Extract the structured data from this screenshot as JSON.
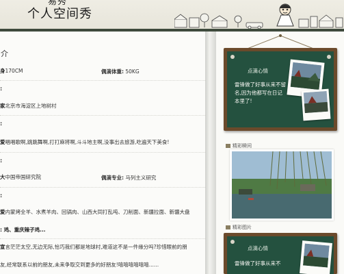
{
  "header": {
    "title": "个人空间秀",
    "title_fragment": "易秀"
  },
  "profile": {
    "section_title": "介",
    "height_label": "身",
    "height_value": "170CM",
    "spouse_weight_label": "偶滴体重:",
    "spouse_weight_value": "50KG",
    "home_label": "家",
    "home_value": "北京市海淀区上地树村",
    "hobby_label": "爱",
    "hobby_value": "唱唱歌啊,跳跳舞啊,打打麻将啊,斗斗地主啊,没事出去旅游,吃遍天下美食!",
    "school_label": "大",
    "school_value": "中国帝国研究院",
    "spouse_major_label": "偶滴专业:",
    "spouse_major_value": "马列主义研究",
    "food_label": "爱",
    "food_value": "内蒙烤全羊、水煮羊肉、回锅肉、山西大同打乱吨、刀削面、新疆拉面、新疆大盘",
    "food_value_2": ": 鸡、重庆辣子鸡...",
    "motto_label": "宣",
    "motto_value": "言茫茫太空,无边无际,恰巧我们都是地球村,难道这不是一件缘分吗?珍惜眼前的朋",
    "motto_value_2": "友,经常联系以前的朋友,未来争取交到更多的好朋友!嘻嘻嘻嘻嘻嘻......",
    "colon": ":"
  },
  "sidebar": {
    "mood_title": "点滴心情",
    "mood_text": "雷锋做了好事从来不留名,因为他都写在日记本里了!",
    "highlight_label": "精彩瞬间",
    "pictures_label": "精彩图片",
    "mood_title_2": "点滴心情",
    "mood_text_2": "雷锋做了好事从来不"
  },
  "colors": {
    "chalkboard": "#24513f",
    "frame": "#6b4a2b",
    "header_rule": "#3e4a3c"
  }
}
